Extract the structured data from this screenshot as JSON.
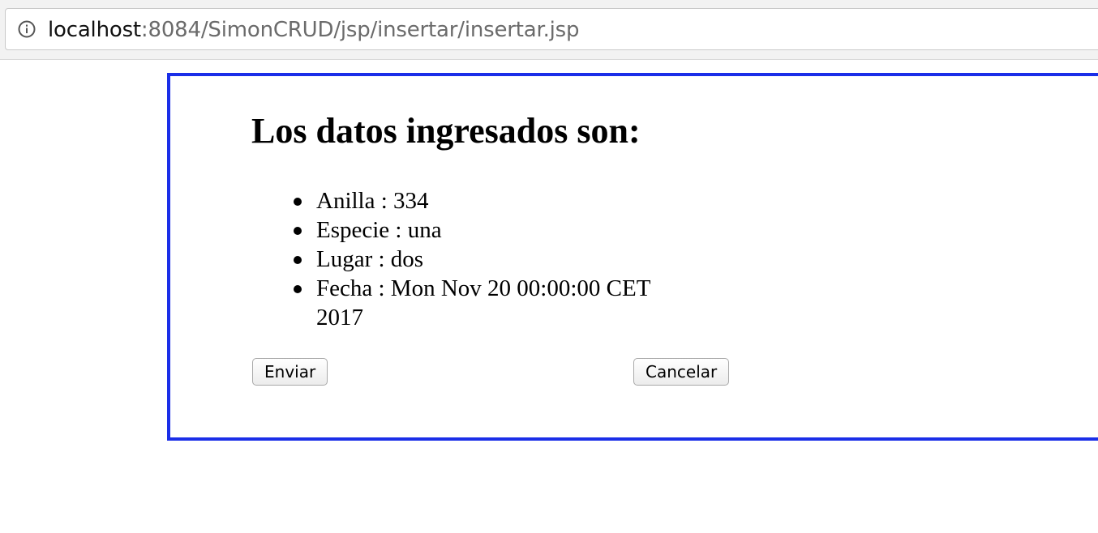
{
  "browser": {
    "url_host": "localhost",
    "url_path": ":8084/SimonCRUD/jsp/insertar/insertar.jsp",
    "info_icon": "info-circle-icon"
  },
  "page": {
    "heading": "Los datos ingresados son:",
    "items": [
      "Anilla : 334",
      "Especie : una",
      "Lugar : dos",
      "Fecha : Mon Nov 20 00:00:00 CET 2017"
    ],
    "submit_label": "Enviar",
    "cancel_label": "Cancelar",
    "border_color": "#1a2ee8"
  }
}
